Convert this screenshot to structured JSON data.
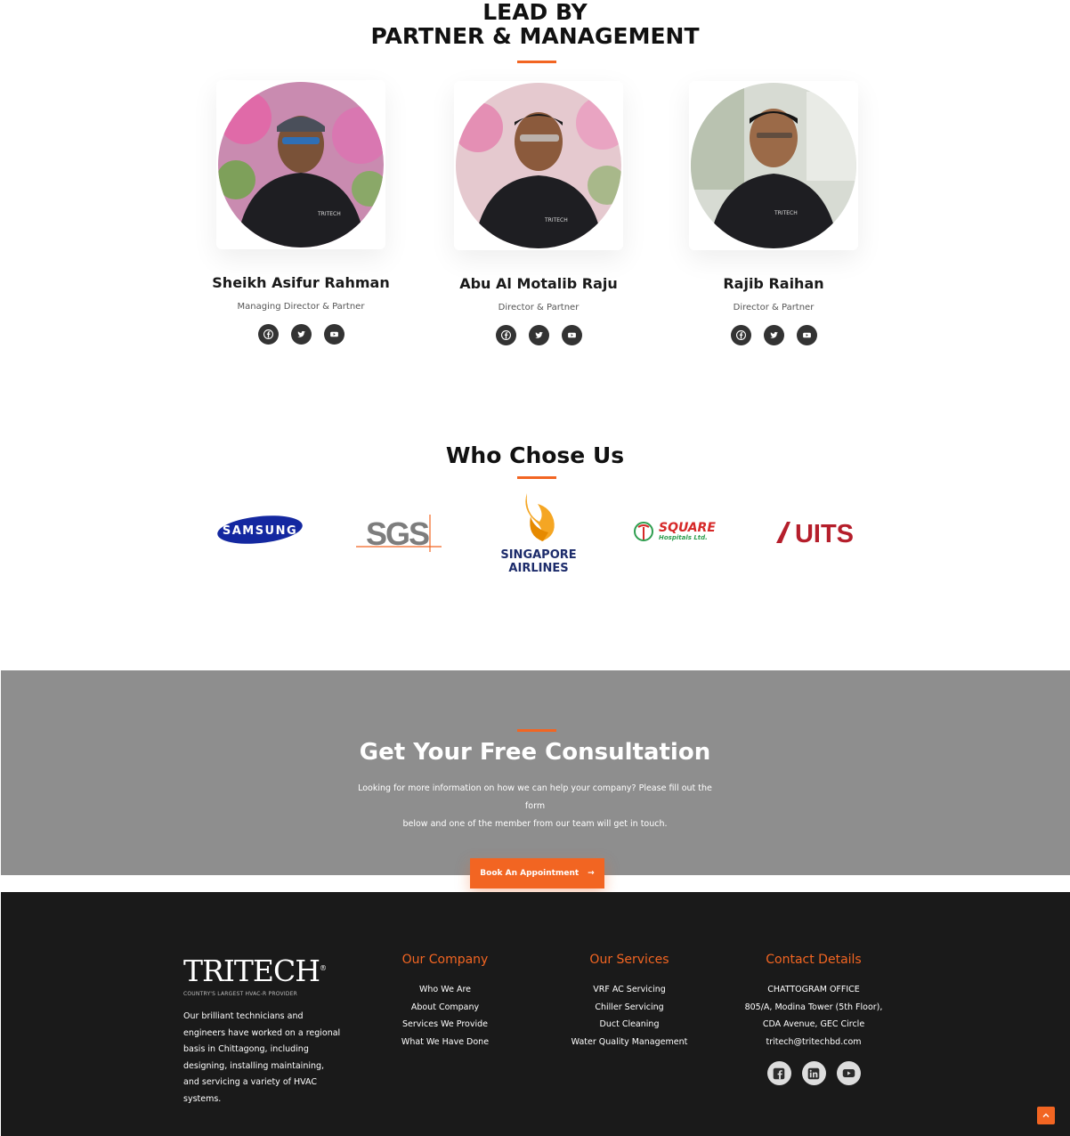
{
  "leadership": {
    "title_line1": "LEAD BY",
    "title_line2": "PARTNER & MANAGEMENT",
    "members": [
      {
        "name": "Sheikh Asifur Rahman",
        "role": "Managing Director & Partner"
      },
      {
        "name": "Abu Al Motalib Raju",
        "role": "Director & Partner"
      },
      {
        "name": "Rajib Raihan",
        "role": "Director & Partner"
      }
    ],
    "member_social_icons": [
      "facebook-icon",
      "twitter-icon",
      "youtube-icon"
    ],
    "shirt_logo_text": "TRITECH"
  },
  "clients": {
    "title": "Who Chose Us",
    "logos": [
      {
        "name": "samsung-logo",
        "text": "SAMSUNG"
      },
      {
        "name": "sgs-logo",
        "text": "SGS"
      },
      {
        "name": "singapore-airlines-logo",
        "text_line1": "SINGAPORE",
        "text_line2": "AIRLINES"
      },
      {
        "name": "square-hospitals-logo",
        "text_line1": "SQUARE",
        "text_line2": "Hospitals Ltd."
      },
      {
        "name": "uits-logo",
        "text": "UITS"
      }
    ]
  },
  "consultation": {
    "title": "Get Your Free Consultation",
    "text_line1": "Looking for more information on how we can help your company? Please fill out the form",
    "text_line2": "below and one of the member from our team will get in touch.",
    "button_label": "Book An Appointment",
    "button_arrow": "→"
  },
  "footer": {
    "brand_name": "TRITECH",
    "brand_reg": "®",
    "brand_tagline": "COUNTRY'S LARGEST HVAC-R PROVIDER",
    "brand_description": "Our brilliant technicians and engineers have worked on a regional basis in Chittagong, including designing, installing maintaining, and servicing a variety of HVAC systems.",
    "company": {
      "title": "Our Company",
      "items": [
        "Who We Are",
        "About Company",
        "Services We Provide",
        "What We Have Done"
      ]
    },
    "services": {
      "title": "Our Services",
      "items": [
        "VRF AC Servicing",
        "Chiller Servicing",
        "Duct Cleaning",
        "Water Quality Management"
      ]
    },
    "contact": {
      "title": "Contact Details",
      "items": [
        "CHATTOGRAM OFFICE",
        "805/A, Modina Tower (5th Floor),",
        "CDA Avenue, GEC Circle",
        "tritech@tritechbd.com"
      ],
      "social_icons": [
        "facebook-square-icon",
        "linkedin-icon",
        "youtube-icon"
      ]
    }
  },
  "colors": {
    "accent": "#f26522",
    "consult_bg": "#8e8e8e",
    "footer_bg": "#1a1a1a"
  }
}
